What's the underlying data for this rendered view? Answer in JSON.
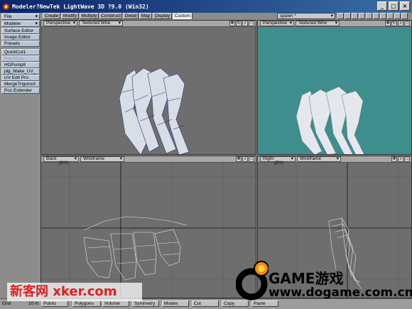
{
  "window": {
    "title": "Modeler?NewTek LightWave 3D ?9.0 (Win32)",
    "controls": [
      "_",
      "□",
      "×"
    ]
  },
  "left_panel": {
    "file_menu": "File",
    "modeler_menu": "Modeler",
    "items": [
      "Surface Editor",
      "Image Editor",
      "Presets"
    ],
    "plugins": [
      "QuickCut1",
      "BandSaw",
      "HDPump8",
      "plg_Make_UV_",
      "UV Edit Pro",
      "MergeTrigonsX",
      "Poz Extender"
    ]
  },
  "tabs": [
    "Create",
    "Modify",
    "Multiply",
    "Construct",
    "Detail",
    "Map",
    "Display",
    "Custom"
  ],
  "active_tab": "Custom",
  "spawn": "spawn *",
  "viewports": {
    "top_left": {
      "view": "Perspective",
      "mode": "Textured Wire",
      "bg": "#6e6e6e"
    },
    "top_right": {
      "view": "Perspective",
      "mode": "Textured Wire",
      "bg": "#3f8e8e"
    },
    "bottom_left": {
      "view": "Back",
      "axis": "(XY)",
      "mode": "Wireframe",
      "bg": "#6e6e6e"
    },
    "bottom_right": {
      "view": "Right",
      "axis": "(ZY)",
      "mode": "Wireframe",
      "bg": "#6e6e6e"
    }
  },
  "bottom_bar": {
    "grid_label": "Grid",
    "grid_value": "10 m",
    "points": "Points",
    "polygons": "Polygons",
    "volume": "Volume",
    "symmetry": "Symmetry",
    "modes": "Modes",
    "cut": "Cut",
    "copy": "Copy",
    "paste": "Paste"
  },
  "watermarks": {
    "left": "新客网 xker.com",
    "right_brand": "GAME游戏",
    "right_url": "www.dogame.com.cn"
  }
}
